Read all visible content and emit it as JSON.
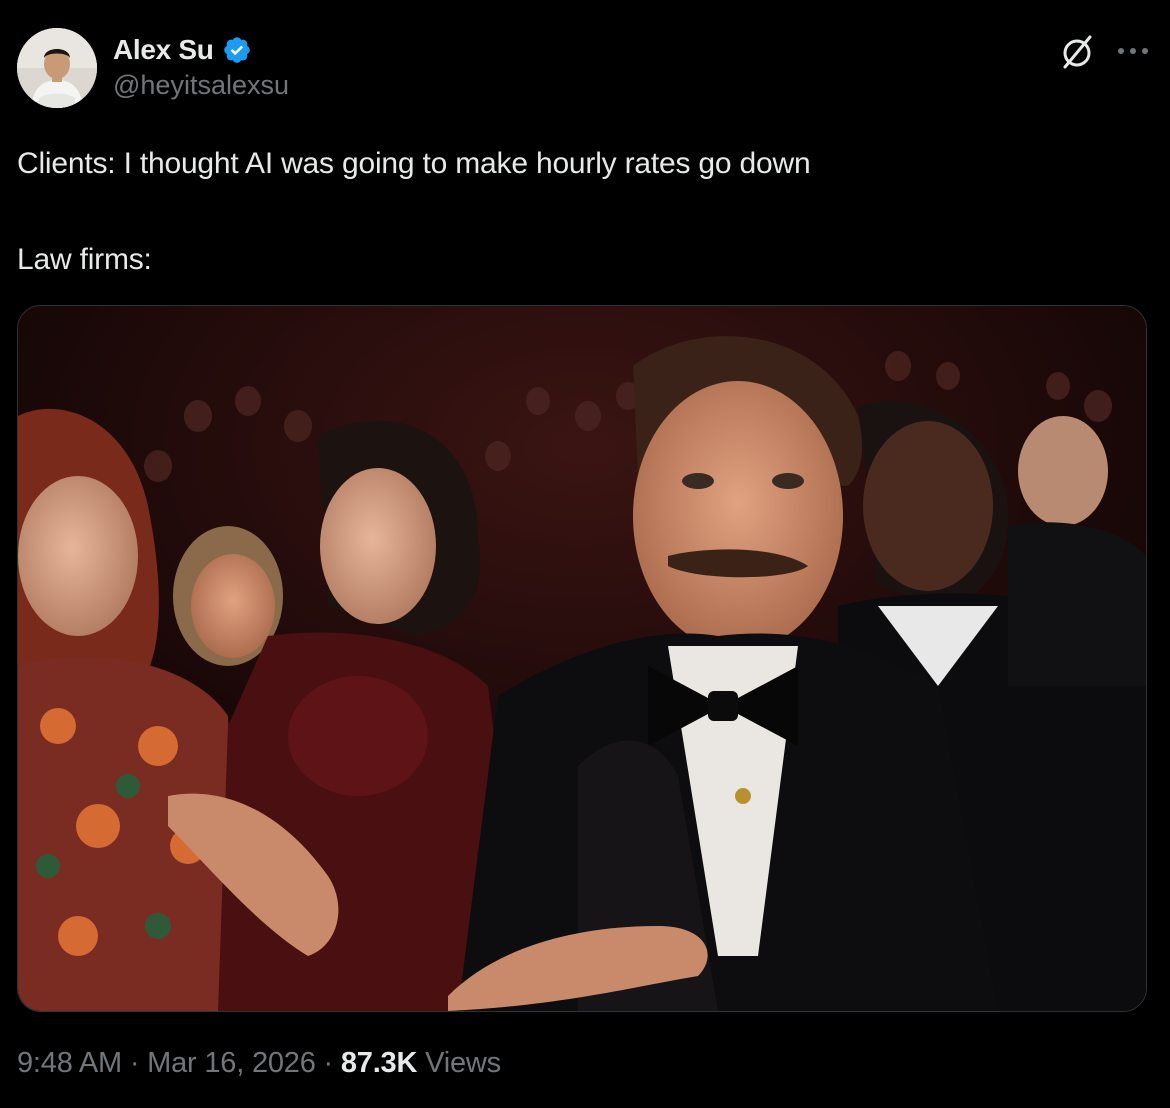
{
  "author": {
    "display_name": "Alex Su",
    "handle": "@heyitsalexsu",
    "verified": true,
    "avatar_icon": "profile-photo"
  },
  "actions": {
    "grok_icon": "grok-icon",
    "more_icon": "more-horizontal-icon"
  },
  "tweet": {
    "line1": "Clients: I thought AI was going to make hourly rates go down",
    "line2": "Law firms:"
  },
  "media": {
    "type": "photo",
    "icon": "meme-photo"
  },
  "meta": {
    "time": "9:48 AM",
    "sep1": " · ",
    "date": "Mar 16, 2026",
    "sep2": " · ",
    "views_count": "87.3K",
    "views_label": " Views"
  },
  "colors": {
    "background": "#000000",
    "text_primary": "#e7e9ea",
    "text_secondary": "#71767b",
    "verified_blue": "#1d9bf0",
    "border": "#2f3336"
  }
}
